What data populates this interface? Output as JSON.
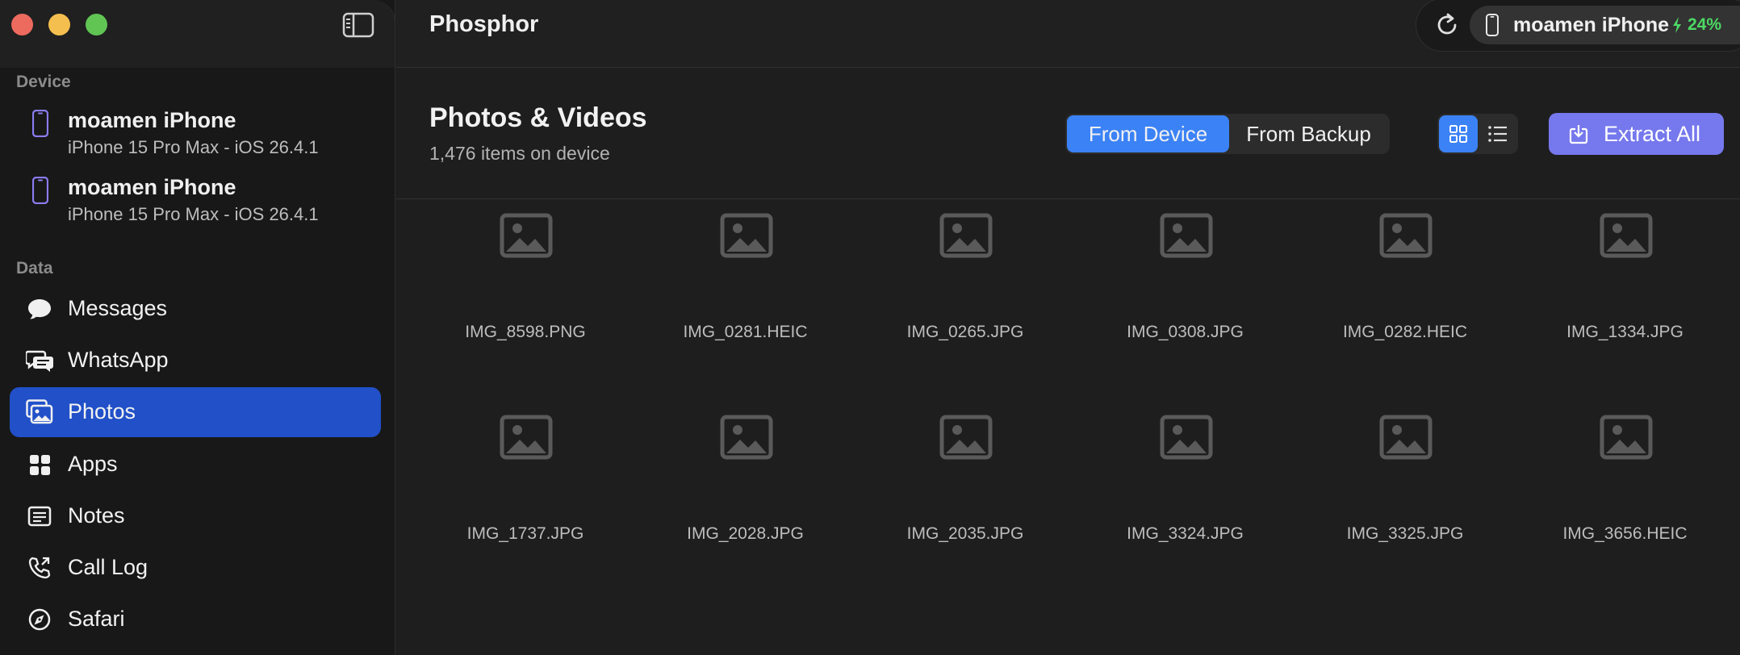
{
  "window": {
    "app_title": "Phosphor"
  },
  "sidebar": {
    "device_section": "Device",
    "devices": [
      {
        "name": "moamen iPhone",
        "subtitle": "iPhone 15 Pro Max - iOS 26.4.1"
      },
      {
        "name": "moamen iPhone",
        "subtitle": "iPhone 15 Pro Max - iOS 26.4.1"
      }
    ],
    "data_section": "Data",
    "items": [
      {
        "label": "Messages",
        "icon": "messages-icon"
      },
      {
        "label": "WhatsApp",
        "icon": "whatsapp-icon"
      },
      {
        "label": "Photos",
        "icon": "photos-icon",
        "active": true
      },
      {
        "label": "Apps",
        "icon": "apps-icon"
      },
      {
        "label": "Notes",
        "icon": "notes-icon"
      },
      {
        "label": "Call Log",
        "icon": "phone-icon"
      },
      {
        "label": "Safari",
        "icon": "compass-icon"
      }
    ]
  },
  "toolbar": {
    "device_name": "moamen iPhone",
    "battery": "24%"
  },
  "header": {
    "title": "Photos & Videos",
    "subtitle": "1,476 items on device",
    "source_tabs": [
      "From Device",
      "From Backup"
    ],
    "selected_source": "From Device",
    "view_mode": "grid",
    "extract_label": "Extract All"
  },
  "files": [
    "IMG_8598.PNG",
    "IMG_0281.HEIC",
    "IMG_0265.JPG",
    "IMG_0308.JPG",
    "IMG_0282.HEIC",
    "IMG_1334.JPG",
    "IMG_1737.JPG",
    "IMG_2028.JPG",
    "IMG_2035.JPG",
    "IMG_3324.JPG",
    "IMG_3325.JPG",
    "IMG_3656.HEIC"
  ],
  "colors": {
    "accent": "#3b82f6",
    "sidebar_active": "#2150c8",
    "extract": "#7678ed",
    "battery": "#4cd964"
  }
}
